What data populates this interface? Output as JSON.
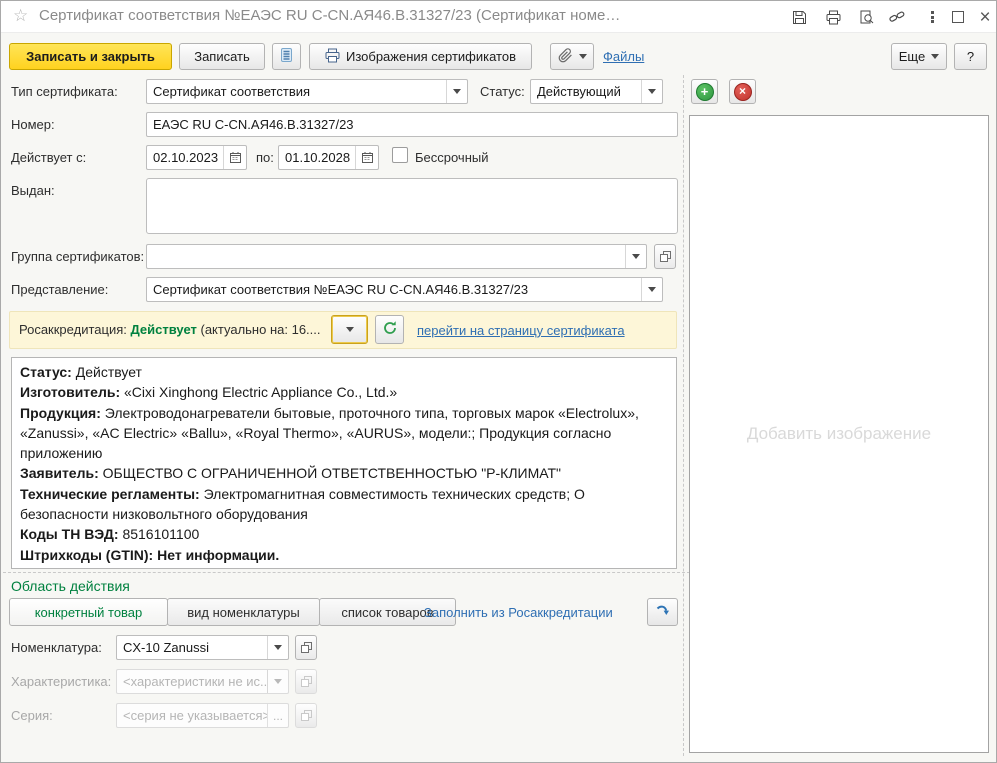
{
  "colors": {
    "primary_button_yellow": "#ffd92e",
    "status_green": "#00813f",
    "link_blue": "#2f6fb3",
    "accreditation_bar_bg": "#fdf6d8"
  },
  "window": {
    "title": "Сертификат соответствия №ЕАЭС RU C-CN.АЯ46.В.31327/23 (Сертификат номе…"
  },
  "toolbar": {
    "save_close": "Записать и закрыть",
    "save": "Записать",
    "images": "Изображения сертификатов",
    "files": "Файлы",
    "more": "Еще",
    "help": "?"
  },
  "form": {
    "type_label": "Тип сертификата:",
    "type_value": "Сертификат соответствия",
    "status_label": "Статус:",
    "status_value": "Действующий",
    "number_label": "Номер:",
    "number_value": "ЕАЭС RU C-CN.АЯ46.В.31327/23",
    "valid_from_label": "Действует с:",
    "valid_from": "02.10.2023",
    "valid_to_label": "по:",
    "valid_to": "01.10.2028",
    "perpetual_label": "Бессрочный",
    "issued_label": "Выдан:",
    "issued_value": "",
    "group_label": "Группа сертификатов:",
    "group_value": "",
    "presentation_label": "Представление:",
    "presentation_value": "Сертификат соответствия №ЕАЭС RU C-CN.АЯ46.В.31327/23"
  },
  "accreditation": {
    "label": "Росаккредитация:",
    "status": "Действует",
    "note": "(актуально на: 16....",
    "link": "перейти на страницу сертификата"
  },
  "details": {
    "lines": [
      {
        "label": "Статус:",
        "value": "Действует"
      },
      {
        "label": "Изготовитель:",
        "value": "«Cixi Xinghong Electric Appliance Co., Ltd.»"
      },
      {
        "label": "Продукция:",
        "value": "Электроводонагреватели бытовые, проточного типа, торговых марок «Electrolux», «Zanussi», «AC Electric» «Ballu», «Royal Thermo», «AURUS», модели:; Продукция согласно приложению"
      },
      {
        "label": "Заявитель:",
        "value": "ОБЩЕСТВО С ОГРАНИЧЕННОЙ ОТВЕТСТВЕННОСТЬЮ \"Р-КЛИМАТ\""
      },
      {
        "label": "Технические регламенты:",
        "value": "Электромагнитная совместимость технических средств; О безопасности низковольтного оборудования"
      },
      {
        "label": "Коды ТН ВЭД:",
        "value": "8516101100"
      },
      {
        "label": "Штрихкоды (GTIN):",
        "value": "Нет информации."
      }
    ]
  },
  "scope": {
    "title": "Область действия",
    "tabs": [
      "конкретный товар",
      "вид номенклатуры",
      "список товаров"
    ],
    "fill_link": "Заполнить из Росаккредитации",
    "nomenclature_label": "Номенклатура:",
    "nomenclature_value": "CX-10 Zanussi",
    "characteristic_label": "Характеристика:",
    "characteristic_placeholder": "<характеристики не ис...",
    "series_label": "Серия:",
    "series_placeholder": "<серия не указывается>",
    "series_more": "..."
  },
  "image_panel": {
    "placeholder": "Добавить изображение"
  }
}
